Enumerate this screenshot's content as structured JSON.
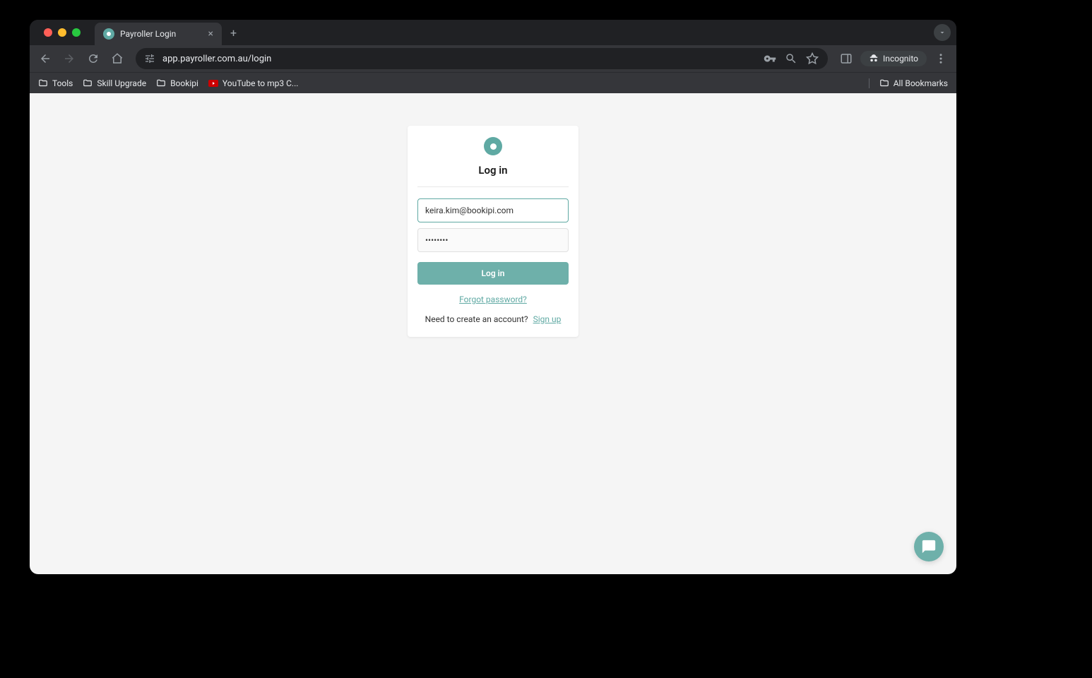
{
  "tab": {
    "title": "Payroller Login"
  },
  "toolbar": {
    "url": "app.payroller.com.au/login",
    "incognito_label": "Incognito"
  },
  "bookmarks": {
    "items": [
      "Tools",
      "Skill Upgrade",
      "Bookipi",
      "YouTube to mp3 C..."
    ],
    "all_bookmarks": "All Bookmarks"
  },
  "login": {
    "title": "Log in",
    "email_value": "keira.kim@bookipi.com",
    "password_value": "••••••••",
    "button_label": "Log in",
    "forgot_label": "Forgot password?",
    "signup_prompt": "Need to create an account?",
    "signup_link": "Sign up"
  }
}
